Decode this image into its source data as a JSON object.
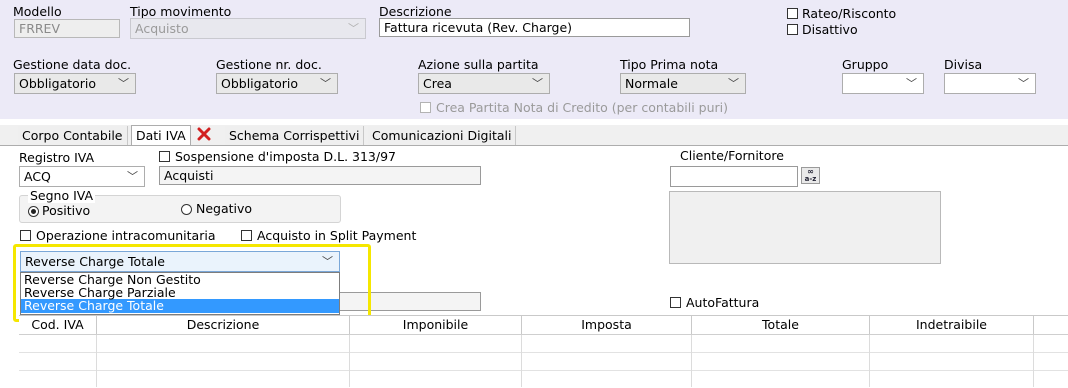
{
  "header": {
    "modello": {
      "label": "Modello",
      "value": "FRREV"
    },
    "tipo_movimento": {
      "label": "Tipo movimento",
      "value": "Acquisto"
    },
    "descrizione": {
      "label": "Descrizione",
      "value": "Fattura ricevuta (Rev. Charge)"
    },
    "rateo_risconto": {
      "label": "Rateo/Risconto",
      "checked": false
    },
    "disattivo": {
      "label": "Disattivo",
      "checked": false
    },
    "gestione_data_doc": {
      "label": "Gestione data doc.",
      "value": "Obbligatorio"
    },
    "gestione_nr_doc": {
      "label": "Gestione nr. doc.",
      "value": "Obbligatorio"
    },
    "azione_partita": {
      "label": "Azione sulla partita",
      "value": "Crea"
    },
    "tipo_prima_nota": {
      "label": "Tipo Prima nota",
      "value": "Normale"
    },
    "gruppo": {
      "label": "Gruppo",
      "value": ""
    },
    "divisa": {
      "label": "Divisa",
      "value": ""
    },
    "crea_partita_nc": {
      "label": "Crea Partita Nota di Credito (per contabili puri)",
      "checked": false
    }
  },
  "tabs": [
    {
      "label": "Corpo Contabile",
      "active": false
    },
    {
      "label": "Dati IVA",
      "active": true
    },
    {
      "label": "Schema Corrispettivi",
      "active": false
    },
    {
      "label": "Comunicazioni Digitali",
      "active": false
    }
  ],
  "iva": {
    "registro_label": "Registro IVA",
    "registro_value": "ACQ",
    "registro_desc": "Acquisti",
    "sospensione_label": "Sospensione d'imposta D.L. 313/97",
    "segno_label": "Segno IVA",
    "positivo_label": "Positivo",
    "negativo_label": "Negativo",
    "segno_selected": "Positivo",
    "intracomunitaria_label": "Operazione intracomunitaria",
    "split_payment_label": "Acquisto in Split Payment",
    "reverse_charge_value": "Reverse Charge Totale",
    "reverse_charge_options": [
      "Reverse Charge Non Gestito",
      "Reverse Charge Parziale",
      "Reverse Charge Totale"
    ],
    "reverse_charge_highlight_color": "#f5e700",
    "cliente_fornitore_label": "Cliente/Fornitore",
    "cliente_fornitore_value": "",
    "search_button_label": "a-z",
    "autofattura_label": "AutoFattura"
  },
  "grid": {
    "columns": [
      "Cod. IVA",
      "Descrizione",
      "Imponibile",
      "Imposta",
      "Totale",
      "Indetraibile"
    ]
  },
  "colors": {
    "header_bg": "#eceaf7",
    "selection": "#3399ff",
    "dropdown_hover": "#cce8ff"
  }
}
